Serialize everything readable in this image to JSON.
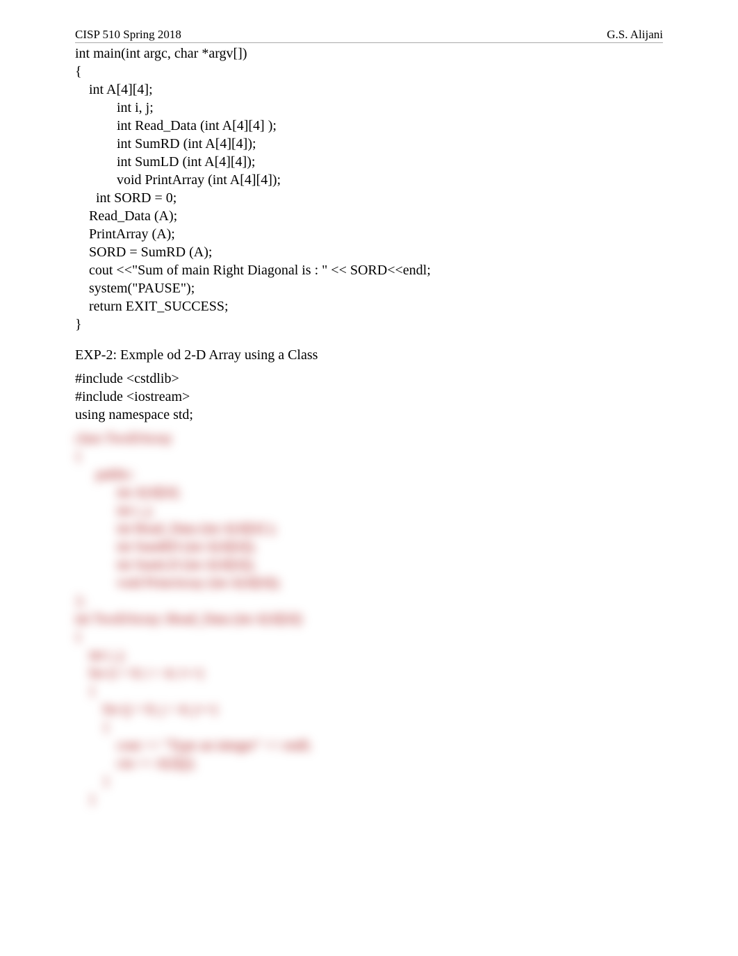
{
  "header": {
    "left": "CISP 510 Spring 2018",
    "right": "G.S. Alijani"
  },
  "code1": [
    "int main(int argc, char *argv[])",
    "{",
    "    int A[4][4];",
    "            int i, j;",
    "            int Read_Data (int A[4][4] );",
    "            int SumRD (int A[4][4]);",
    "            int SumLD (int A[4][4]);",
    "            void PrintArray (int A[4][4]);",
    "      int SORD = 0;",
    "",
    "    Read_Data (A);",
    "    PrintArray (A);",
    "    SORD = SumRD (A);",
    "    cout <<\"Sum of main Right Diagonal is : \" << SORD<<endl;",
    "    system(\"PAUSE\");",
    "    return EXIT_SUCCESS;",
    "}"
  ],
  "section_heading": "EXP-2: Exmple od 2-D Array using a Class",
  "code2": [
    "#include <cstdlib>",
    "#include <iostream>",
    "using namespace std;"
  ],
  "blurred": [
    "class TwoDArray",
    "{",
    "      public:",
    "            int A[4][4];",
    "            int i, j;",
    "            int Read_Data (int A[4][4] );",
    "            int SumRD (int A[4][4]);",
    "            int SumLD (int A[4][4]);",
    "            void PrintArray (int A[4][4]);",
    "};",
    "int TwoDArray::Read_Data (int A[4][4])",
    "{",
    "    int i, j;",
    "    for (i = 0; i < 4; i++)",
    "    {",
    "        for (j = 0; j < 4; j++)",
    "        {",
    "            cout << \"Type an integer\" << endl;",
    "            cin >> A[i][j];",
    "        }",
    "    }"
  ]
}
